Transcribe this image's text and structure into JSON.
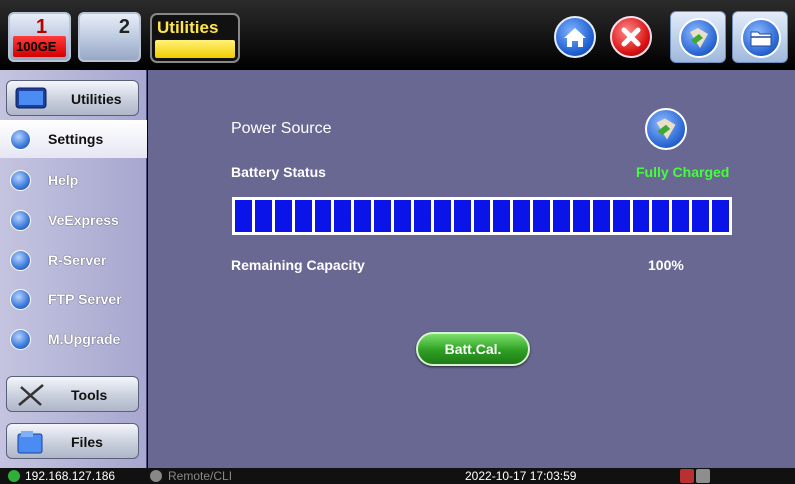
{
  "ports": [
    {
      "number": "1",
      "rate": "100GE"
    },
    {
      "number": "2"
    }
  ],
  "title": "Utilities",
  "toolbar": {
    "home_icon": "home-icon",
    "close_icon": "close-icon",
    "utilities_icon": "utilities-icon",
    "files_icon": "folder-icon"
  },
  "sidebar": {
    "header": "Utilities",
    "items": [
      {
        "label": "Settings",
        "icon": "settings-icon"
      },
      {
        "label": "Help",
        "icon": "help-icon"
      },
      {
        "label": "VeExpress",
        "icon": "veexpress-icon"
      },
      {
        "label": "R-Server",
        "icon": "r-server-icon"
      },
      {
        "label": "FTP Server",
        "icon": "ftp-server-icon"
      },
      {
        "label": "M.Upgrade",
        "icon": "upgrade-icon"
      }
    ],
    "tools": "Tools",
    "files": "Files"
  },
  "main": {
    "title": "Power Source",
    "battery_label": "Battery Status",
    "battery_status": "Fully Charged",
    "battery_segments": 25,
    "battery_level_fraction": 1.0,
    "remaining_label": "Remaining Capacity",
    "remaining_value": "100%",
    "calibrate_button": "Batt.Cal.",
    "status_color": "#43ff39"
  },
  "status": {
    "ip": "192.168.127.186",
    "remote": "Remote/CLI",
    "datetime": "2022-10-17  17:03:59"
  }
}
